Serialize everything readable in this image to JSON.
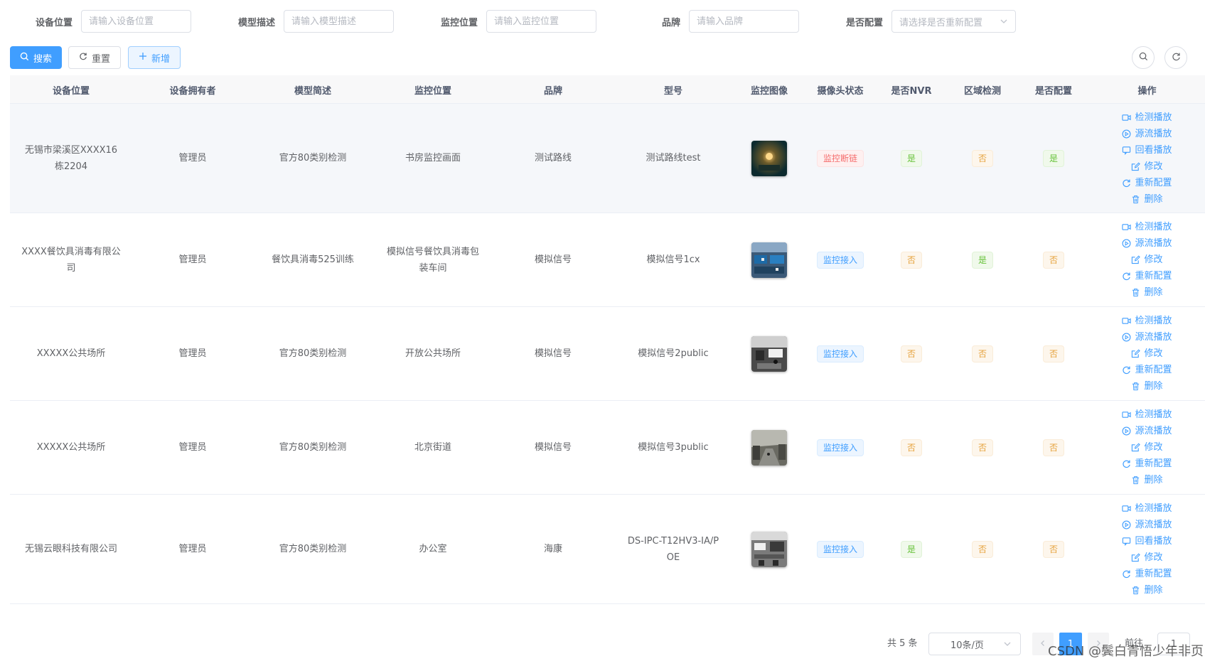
{
  "search_form": {
    "fields": [
      {
        "label": "设备位置",
        "placeholder": "请输入设备位置"
      },
      {
        "label": "模型描述",
        "placeholder": "请输入模型描述"
      },
      {
        "label": "监控位置",
        "placeholder": "请输入监控位置"
      },
      {
        "label": "品牌",
        "placeholder": "请输入品牌"
      },
      {
        "label": "是否配置",
        "placeholder": "请选择是否重新配置"
      }
    ]
  },
  "toolbar": {
    "search_label": "搜索",
    "reset_label": "重置",
    "add_label": "新增"
  },
  "table": {
    "columns": [
      "设备位置",
      "设备拥有者",
      "模型简述",
      "监控位置",
      "品牌",
      "型号",
      "监控图像",
      "摄像头状态",
      "是否NVR",
      "区域检测",
      "是否配置",
      "操作"
    ],
    "rows": [
      {
        "device_location": "无锡市梁溪区XXXX16栋2204",
        "owner": "管理员",
        "model_desc": "官方80类别检测",
        "monitor_location": "书房监控画面",
        "brand": "测试路线",
        "model_no": "测试路线test",
        "image_icon": "game-scene-thumbnail",
        "camera_status": "监控断链",
        "is_nvr": "是",
        "region_detect": "否",
        "configured": "是",
        "ops": [
          "检测播放",
          "源流播放",
          "回看播放",
          "修改",
          "重新配置",
          "删除"
        ]
      },
      {
        "device_location": "XXXX餐饮具消毒有限公司",
        "owner": "管理员",
        "model_desc": "餐饮具消毒525训练",
        "monitor_location": "模拟信号餐饮具消毒包装车间",
        "brand": "模拟信号",
        "model_no": "模拟信号1cx",
        "image_icon": "workshop-thumbnail",
        "camera_status": "监控接入",
        "is_nvr": "否",
        "region_detect": "是",
        "configured": "否",
        "ops": [
          "检测播放",
          "源流播放",
          "修改",
          "重新配置",
          "删除"
        ]
      },
      {
        "device_location": "XXXXX公共场所",
        "owner": "管理员",
        "model_desc": "官方80类别检测",
        "monitor_location": "开放公共场所",
        "brand": "模拟信号",
        "model_no": "模拟信号2public",
        "image_icon": "public-place-thumbnail",
        "camera_status": "监控接入",
        "is_nvr": "否",
        "region_detect": "否",
        "configured": "否",
        "ops": [
          "检测播放",
          "源流播放",
          "修改",
          "重新配置",
          "删除"
        ]
      },
      {
        "device_location": "XXXXX公共场所",
        "owner": "管理员",
        "model_desc": "官方80类别检测",
        "monitor_location": "北京街道",
        "brand": "模拟信号",
        "model_no": "模拟信号3public",
        "image_icon": "street-thumbnail",
        "camera_status": "监控接入",
        "is_nvr": "否",
        "region_detect": "否",
        "configured": "否",
        "ops": [
          "检测播放",
          "源流播放",
          "修改",
          "重新配置",
          "删除"
        ]
      },
      {
        "device_location": "无锡云眼科技有限公司",
        "owner": "管理员",
        "model_desc": "官方80类别检测",
        "monitor_location": "办公室",
        "brand": "海康",
        "model_no": "DS-IPC-T12HV3-IA/POE",
        "image_icon": "office-thumbnail",
        "camera_status": "监控接入",
        "is_nvr": "是",
        "region_detect": "否",
        "configured": "否",
        "ops": [
          "检测播放",
          "源流播放",
          "回看播放",
          "修改",
          "重新配置",
          "删除"
        ]
      }
    ]
  },
  "pagination": {
    "total_text": "共 5 条",
    "page_size": "10条/页",
    "current_page": "1",
    "goto_label": "前往",
    "goto_value": "1"
  },
  "watermark": "CSDN @鬓白青悟少年非页",
  "colors": {
    "primary": "#409eff",
    "success": "#67c23a",
    "warning": "#e6a23c",
    "danger": "#f56c6c"
  }
}
